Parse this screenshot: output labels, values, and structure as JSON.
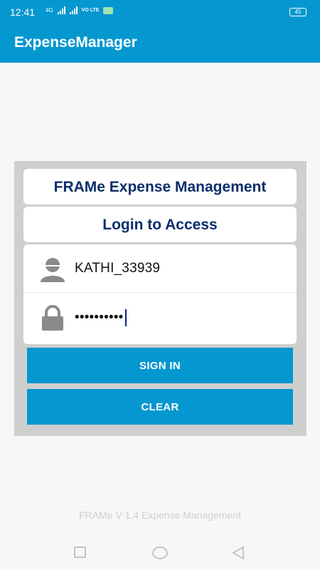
{
  "status_bar": {
    "time": "12:41",
    "network": "4G",
    "volte": "VO LTE",
    "battery": "45"
  },
  "app": {
    "title": "ExpenseManager"
  },
  "login": {
    "header": "FRAMe Expense Management",
    "subheader": "Login to Access",
    "username": "KATHI_33939",
    "password_mask": "••••••••••"
  },
  "buttons": {
    "sign_in": "SIGN IN",
    "clear": "CLEAR"
  },
  "footer": {
    "text": "FRAMe V 1.4 Expense Management"
  },
  "colors": {
    "primary": "#0597cf",
    "title_text": "#0b2e6b",
    "panel": "#cfcfcf"
  },
  "icons": [
    "user-icon",
    "lock-icon",
    "square-recent-icon",
    "circle-home-icon",
    "triangle-back-icon"
  ]
}
